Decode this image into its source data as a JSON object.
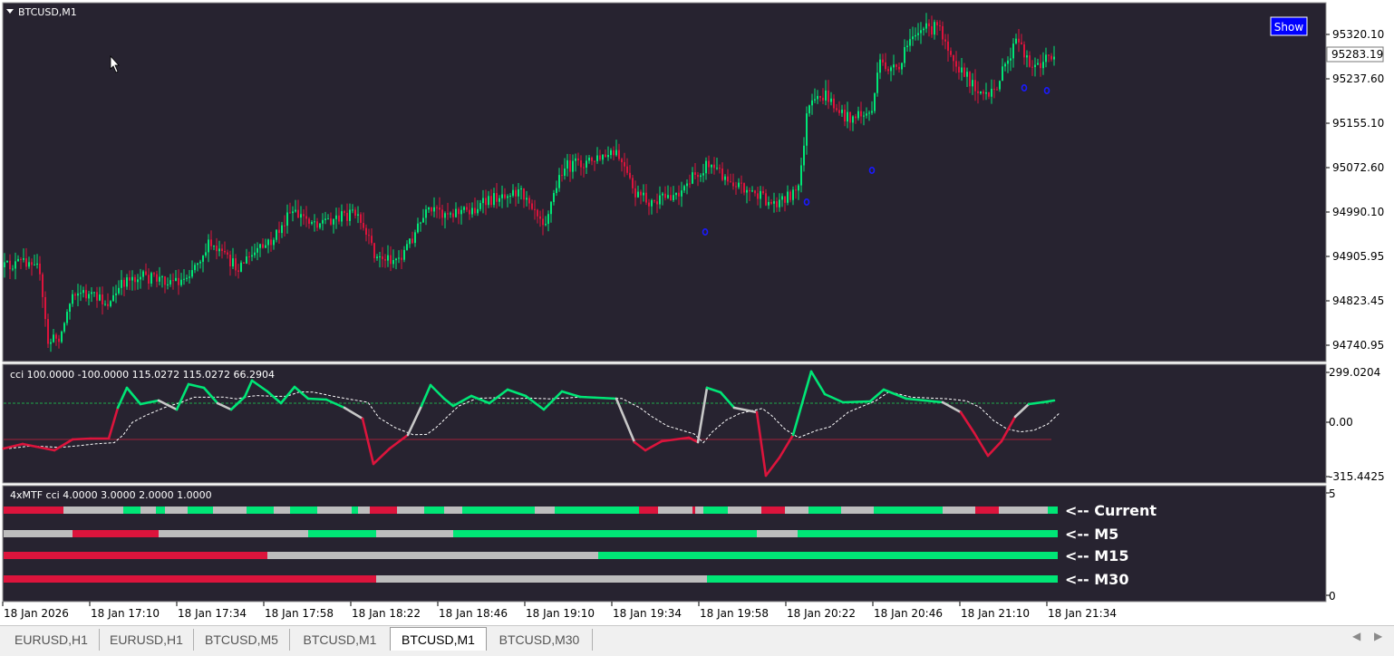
{
  "window": {
    "symbol_title": "BTCUSD,M1",
    "show_button_label": "Show"
  },
  "price_pane": {
    "y_ticks": [
      "95320.10",
      "95237.60",
      "95155.10",
      "95072.60",
      "94990.10",
      "94905.95",
      "94823.45",
      "94740.95"
    ],
    "current_price": "95283.19",
    "colors": {
      "bull": "#00e676",
      "bear": "#dc143c",
      "background": "#272330",
      "signal": "#1a1aff"
    }
  },
  "cci_pane": {
    "label": "cci  100.0000 -100.0000 115.0272 115.0272 66.2904",
    "y_ticks": [
      "299.0204",
      "0.00",
      "-315.4425"
    ]
  },
  "mtf_pane": {
    "label": "4xMTF cci  4.0000 3.0000 2.0000 1.0000",
    "y_ticks": [
      "5",
      "0"
    ],
    "rows": [
      {
        "label": "<-- Current"
      },
      {
        "label": "<-- M5"
      },
      {
        "label": "<-- M15"
      },
      {
        "label": "<-- M30"
      }
    ]
  },
  "time_axis": [
    "18 Jan 2026",
    "18 Jan 17:10",
    "18 Jan 17:34",
    "18 Jan 17:58",
    "18 Jan 18:22",
    "18 Jan 18:46",
    "18 Jan 19:10",
    "18 Jan 19:34",
    "18 Jan 19:58",
    "18 Jan 20:22",
    "18 Jan 20:46",
    "18 Jan 21:10",
    "18 Jan 21:34"
  ],
  "tabs": [
    {
      "label": "EURUSD,H1"
    },
    {
      "label": "EURUSD,H1"
    },
    {
      "label": "BTCUSD,M5"
    },
    {
      "label": "BTCUSD,M1"
    },
    {
      "label": "BTCUSD,M1",
      "active": true
    },
    {
      "label": "BTCUSD,M30"
    }
  ],
  "scroll_arrows": {
    "left": "◀",
    "right": "▶"
  }
}
